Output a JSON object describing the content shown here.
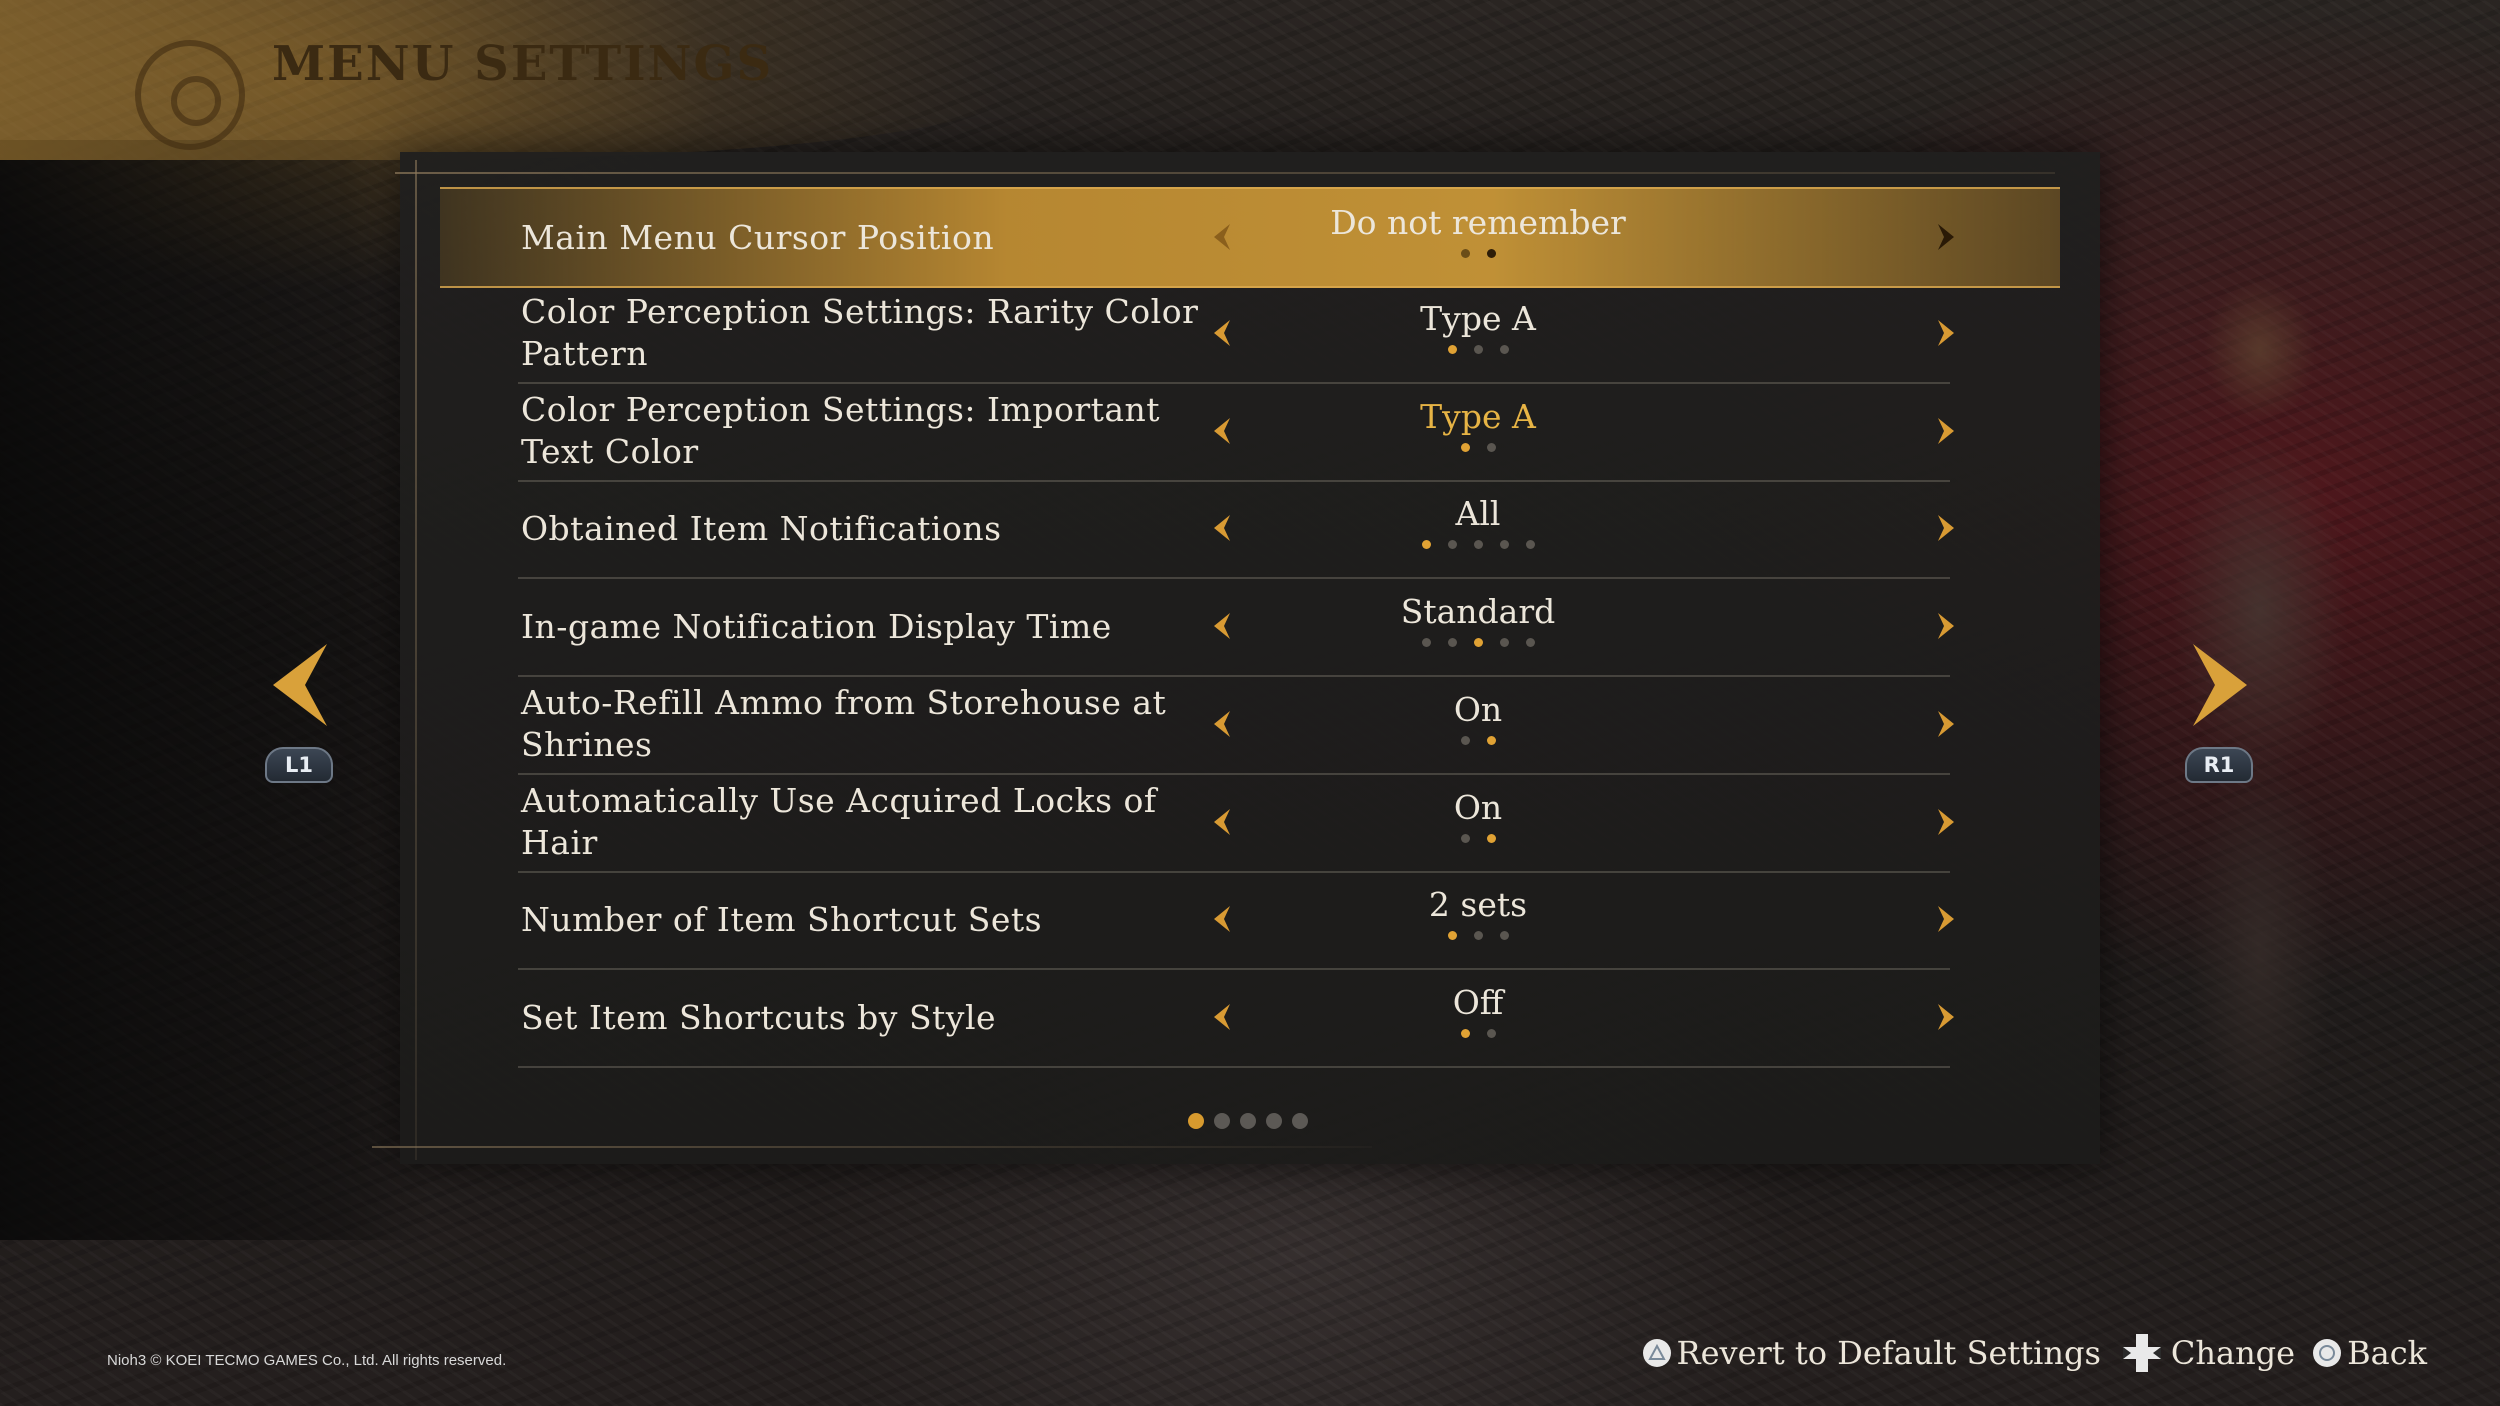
{
  "header": {
    "title": "MENU SETTINGS",
    "icon": "gear-icon"
  },
  "colors": {
    "accent": "#e0a234",
    "highlight_value": "#e7b445",
    "text": "#ece6da"
  },
  "settings": [
    {
      "label": "Main Menu Cursor Position",
      "value": "Do not remember",
      "options_count": 2,
      "selected_index": 1,
      "highlighted": false,
      "selected": true
    },
    {
      "label": "Color Perception Settings: Rarity Color Pattern",
      "value": "Type A",
      "options_count": 3,
      "selected_index": 0,
      "highlighted": false,
      "selected": false
    },
    {
      "label": "Color Perception Settings: Important Text Color",
      "value": "Type A",
      "options_count": 2,
      "selected_index": 0,
      "highlighted": true,
      "selected": false
    },
    {
      "label": "Obtained Item Notifications",
      "value": "All",
      "options_count": 5,
      "selected_index": 0,
      "highlighted": false,
      "selected": false
    },
    {
      "label": "In-game Notification Display Time",
      "value": "Standard",
      "options_count": 5,
      "selected_index": 2,
      "highlighted": false,
      "selected": false
    },
    {
      "label": "Auto-Refill Ammo from Storehouse at Shrines",
      "value": "On",
      "options_count": 2,
      "selected_index": 1,
      "highlighted": false,
      "selected": false
    },
    {
      "label": "Automatically Use Acquired Locks of Hair",
      "value": "On",
      "options_count": 2,
      "selected_index": 1,
      "highlighted": false,
      "selected": false
    },
    {
      "label": "Number of Item Shortcut Sets",
      "value": "2 sets",
      "options_count": 3,
      "selected_index": 0,
      "highlighted": false,
      "selected": false
    },
    {
      "label": "Set Item Shortcuts by Style",
      "value": "Off",
      "options_count": 2,
      "selected_index": 0,
      "highlighted": false,
      "selected": false
    }
  ],
  "pagination": {
    "pages": 5,
    "current": 1
  },
  "nav": {
    "left_button": "L1",
    "right_button": "R1"
  },
  "footer": {
    "copyright": "Nioh3 © KOEI TECMO GAMES Co., Ltd. All rights reserved.",
    "actions": [
      {
        "icon": "triangle-button-icon",
        "label": "Revert to Default Settings"
      },
      {
        "icon": "dpad-icon",
        "label": "Change"
      },
      {
        "icon": "circle-button-icon",
        "label": "Back"
      }
    ]
  }
}
